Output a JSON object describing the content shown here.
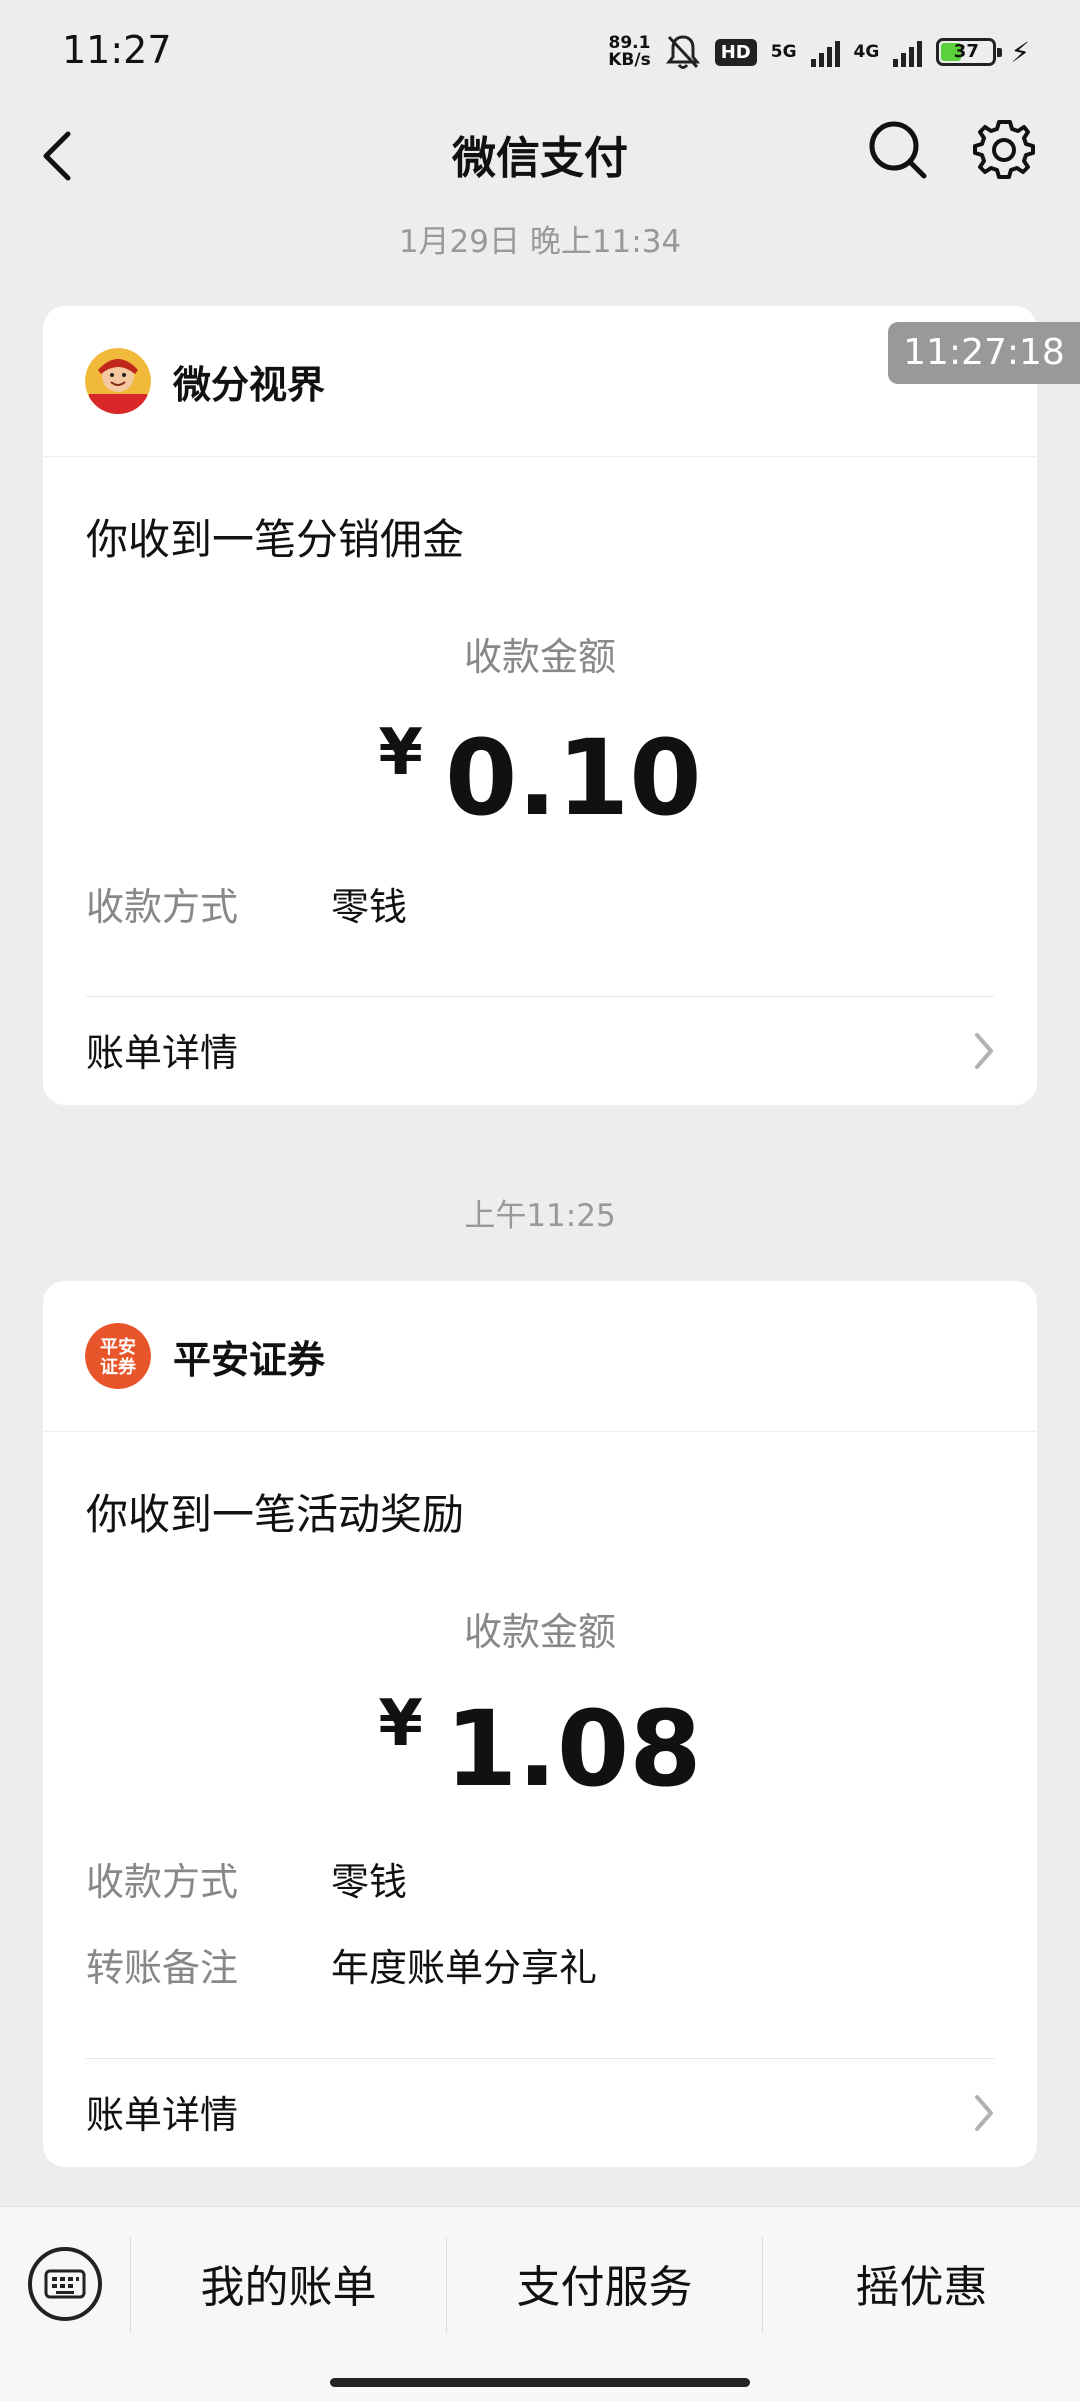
{
  "status_bar": {
    "time": "11:27",
    "net_speed_value": "89.1",
    "net_speed_unit": "KB/s",
    "hd_badge": "HD",
    "net_5g": "5G",
    "net_4g": "4G",
    "battery": "37",
    "icons": [
      "mute-bell-icon",
      "signal-icon",
      "battery-icon",
      "charging-icon"
    ]
  },
  "nav": {
    "title": "微信支付",
    "back_icon": "back-arrow-icon",
    "search_icon": "search-icon",
    "settings_icon": "gear-icon"
  },
  "screenshot_timestamp": "11:27:18",
  "messages": [
    {
      "time": "1月29日 晚上11:34",
      "merchant": "微分视界",
      "notice": "你收到一笔分销佣金",
      "amount_label": "收款金额",
      "currency": "¥",
      "amount": "0.10",
      "rows": [
        {
          "label": "收款方式",
          "value": "零钱"
        }
      ],
      "detail_link": "账单详情"
    },
    {
      "time": "上午11:25",
      "merchant": "平安证券",
      "merchant_logo_text": "平安\n证券",
      "notice": "你收到一笔活动奖励",
      "amount_label": "收款金额",
      "currency": "¥",
      "amount": "1.08",
      "rows": [
        {
          "label": "收款方式",
          "value": "零钱"
        },
        {
          "label": "转账备注",
          "value": "年度账单分享礼"
        }
      ],
      "detail_link": "账单详情"
    }
  ],
  "bottom_bar": {
    "keyboard_icon": "keyboard-icon",
    "tabs": [
      "我的账单",
      "支付服务",
      "摇优惠"
    ]
  },
  "colors": {
    "background": "#ededed",
    "card": "#ffffff",
    "pingan_orange": "#e8552a"
  }
}
